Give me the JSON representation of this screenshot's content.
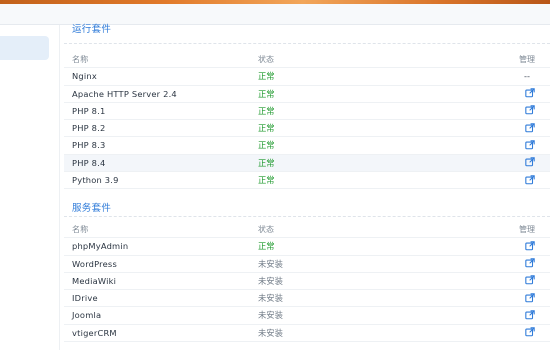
{
  "colors": {
    "accent": "#2f7bd9",
    "status_ok": "#1f9a2e",
    "status_none": "#6f7a86"
  },
  "section1": {
    "title": "运行套件",
    "headers": {
      "name": "名称",
      "status": "状态",
      "manage": "管理"
    },
    "rows": [
      {
        "name": "Nginx",
        "status": "正常",
        "manage": "--"
      },
      {
        "name": "Apache HTTP Server 2.4",
        "status": "正常",
        "manage": "link-icon"
      },
      {
        "name": "PHP 8.1",
        "status": "正常",
        "manage": "link-icon"
      },
      {
        "name": "PHP 8.2",
        "status": "正常",
        "manage": "link-icon"
      },
      {
        "name": "PHP 8.3",
        "status": "正常",
        "manage": "link-icon"
      },
      {
        "name": "PHP 8.4",
        "status": "正常",
        "manage": "link-icon"
      },
      {
        "name": "Python 3.9",
        "status": "正常",
        "manage": "link-icon"
      }
    ]
  },
  "section2": {
    "title": "服务套件",
    "headers": {
      "name": "名称",
      "status": "状态",
      "manage": "管理"
    },
    "rows": [
      {
        "name": "phpMyAdmin",
        "status": "正常",
        "manage": "link-icon"
      },
      {
        "name": "WordPress",
        "status": "未安装",
        "manage": "link-icon"
      },
      {
        "name": "MediaWiki",
        "status": "未安装",
        "manage": "link-icon"
      },
      {
        "name": "IDrive",
        "status": "未安装",
        "manage": "link-icon"
      },
      {
        "name": "Joomla",
        "status": "未安装",
        "manage": "link-icon"
      },
      {
        "name": "vtigerCRM",
        "status": "未安装",
        "manage": "link-icon"
      }
    ]
  }
}
